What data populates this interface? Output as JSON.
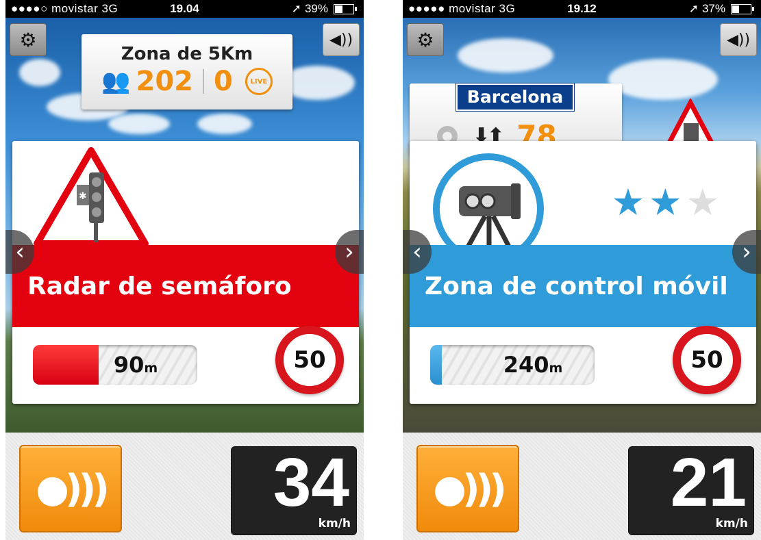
{
  "phone1": {
    "status": {
      "carrier": "●●●●○ movistar  3G",
      "time": "19.04",
      "battery": "39%",
      "battery_fraction": 0.39
    },
    "zone": {
      "title": "Zona de 5Km",
      "users": "202",
      "reports": "0",
      "live_label": "LIVE"
    },
    "alert": {
      "title": "Radar de semáforo",
      "distance": "90",
      "distance_unit": "m",
      "distance_fill": 0.4,
      "speed_limit": "50",
      "band_color": "#e3000f"
    },
    "speed": {
      "value": "34",
      "unit": "km/h"
    }
  },
  "phone2": {
    "status": {
      "carrier": "●●●●● movistar  3G",
      "time": "19.12",
      "battery": "37%",
      "battery_fraction": 0.37
    },
    "city": {
      "name": "Barcelona",
      "count": "78"
    },
    "alert": {
      "title": "Zona de control móvil",
      "distance": "240",
      "distance_unit": "m",
      "distance_fill": 0.07,
      "speed_limit": "50",
      "rating": 2,
      "rating_max": 3,
      "band_color": "#2f9bd8"
    },
    "speed": {
      "value": "21",
      "unit": "km/h"
    }
  },
  "icons": {
    "settings": "gear-icon",
    "sound": "speaker-icon",
    "users": "people-icon",
    "live": "live-icon",
    "prev": "chevron-left-icon",
    "next": "chevron-right-icon",
    "alert": "radar-alert-icon"
  },
  "colors": {
    "orange": "#f0900e",
    "red": "#e3000f",
    "blue": "#2f9bd8"
  }
}
